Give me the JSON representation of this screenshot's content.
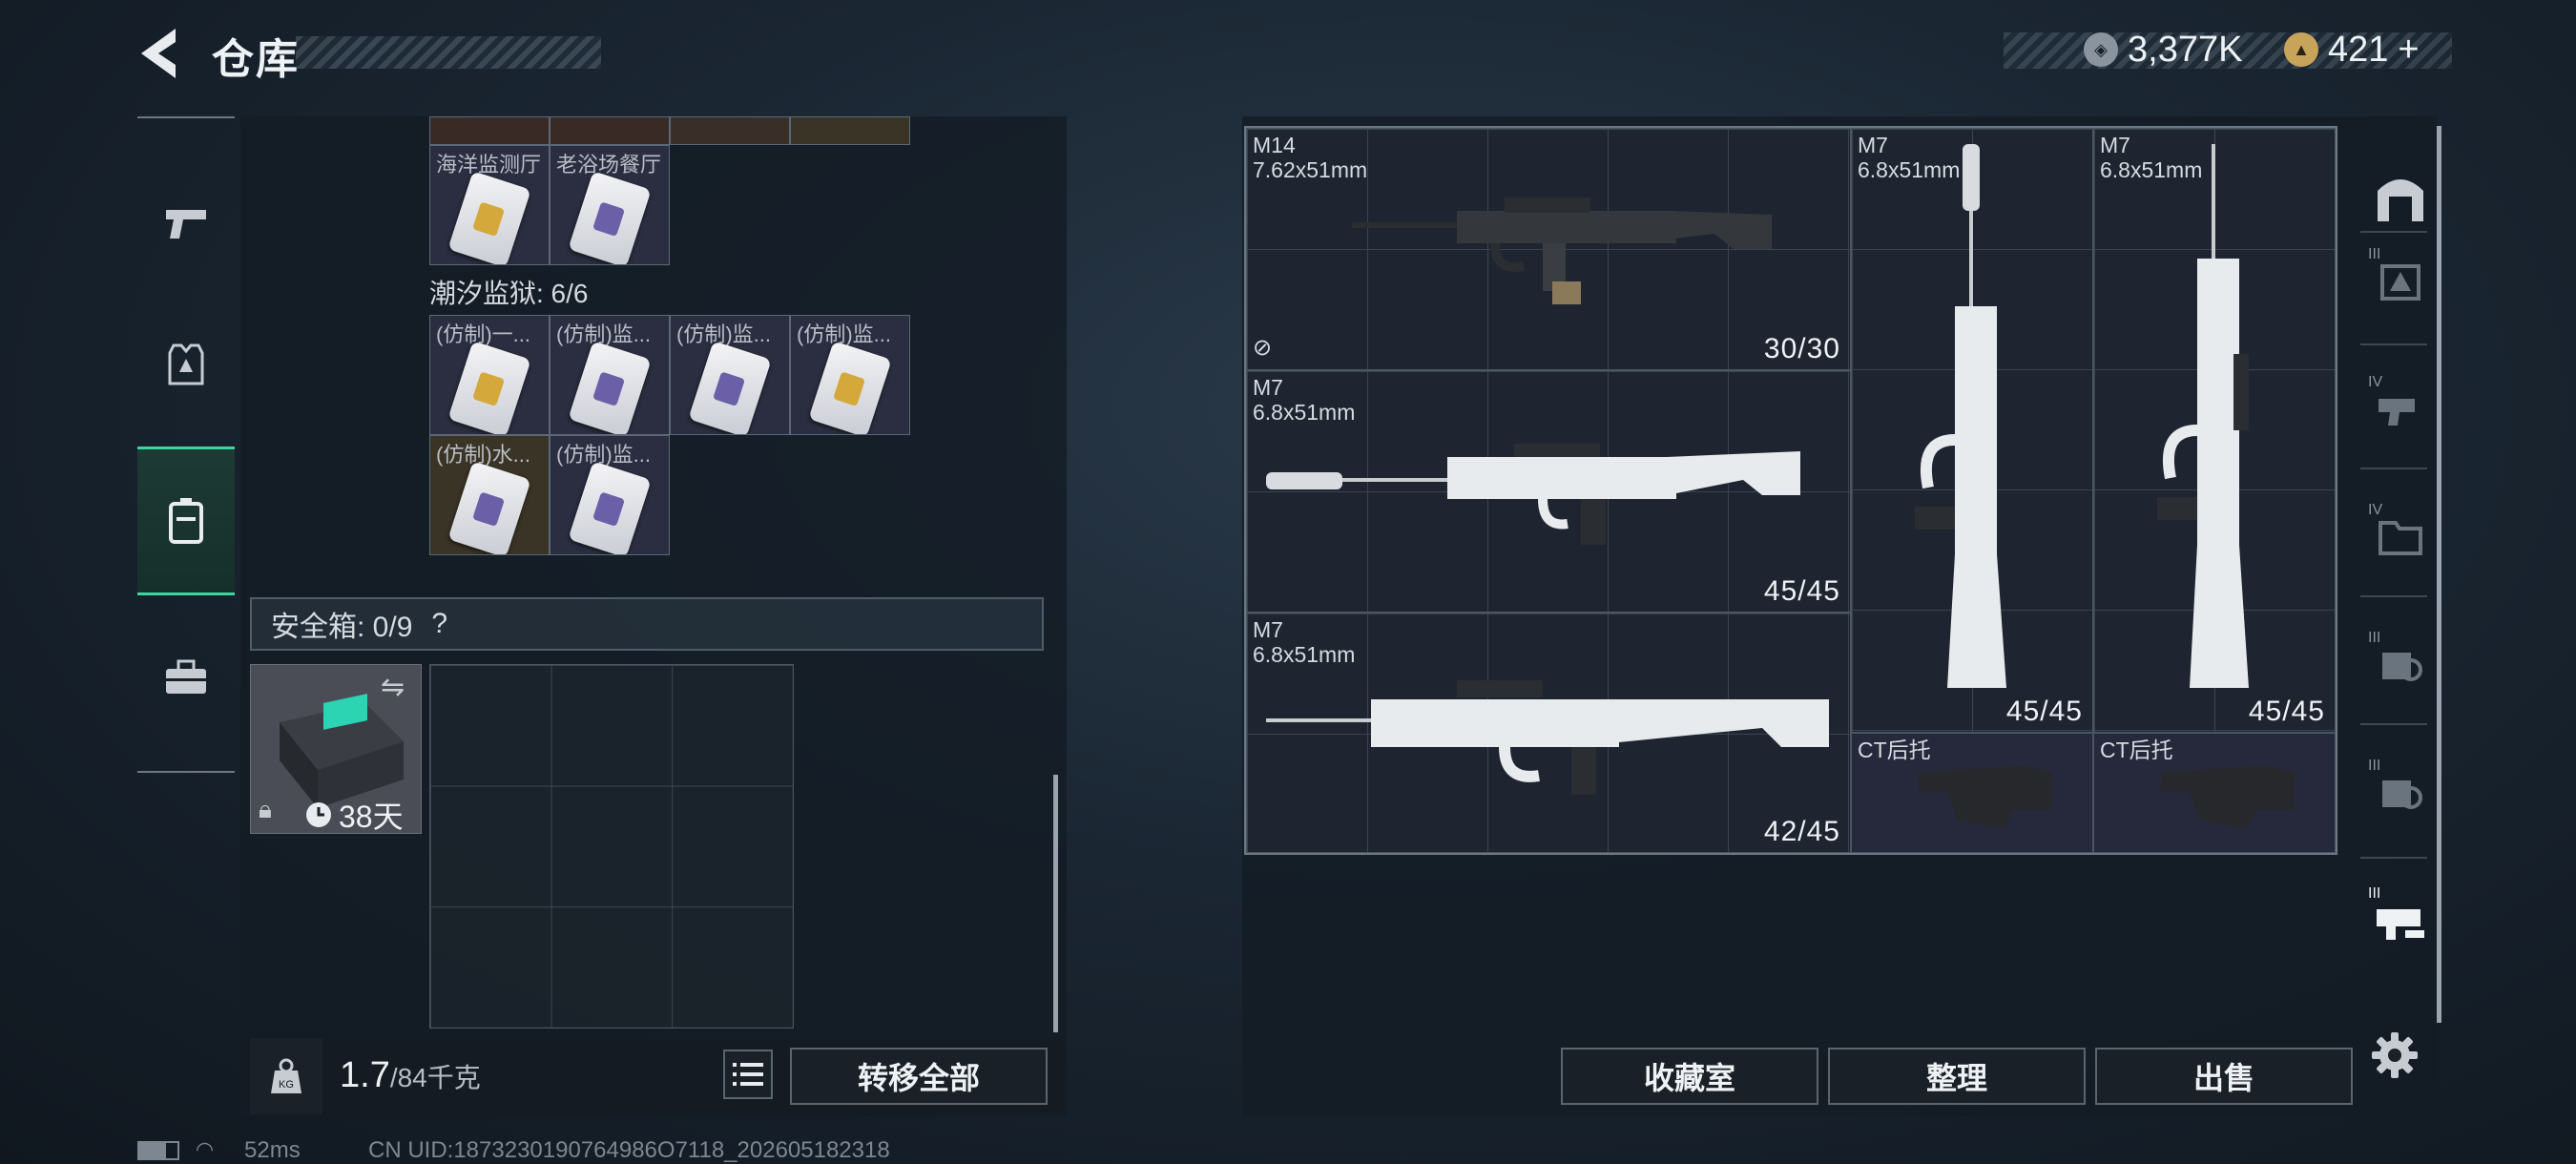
{
  "header": {
    "title": "仓库"
  },
  "currency": [
    {
      "icon": "silver-coin-icon",
      "value": "3,377K",
      "color": "#b8bec6"
    },
    {
      "icon": "gold-coin-icon",
      "value": "421",
      "plus": "+",
      "color": "#c8a45a"
    }
  ],
  "left_nav": [
    {
      "icon": "pistol-icon"
    },
    {
      "icon": "armor-icon"
    },
    {
      "icon": "backpack-icon",
      "active": true
    },
    {
      "icon": "briefcase-icon"
    }
  ],
  "inventory": {
    "top_row": [
      {
        "label": "海洋监测厅",
        "tint": "yellow"
      },
      {
        "label": "老浴场餐厅",
        "tint": "purple"
      }
    ],
    "group_title": "潮汐监狱: 6/6",
    "group_items": [
      {
        "label": "(仿制)一...",
        "tint": "yellow",
        "bg": "purple"
      },
      {
        "label": "(仿制)监...",
        "tint": "purple",
        "bg": "purple"
      },
      {
        "label": "(仿制)监...",
        "tint": "purple",
        "bg": "purple"
      },
      {
        "label": "(仿制)监...",
        "tint": "yellow",
        "bg": "purple"
      },
      {
        "label": "(仿制)水...",
        "tint": "purple",
        "bg": "gold"
      },
      {
        "label": "(仿制)监...",
        "tint": "purple",
        "bg": "purple"
      }
    ]
  },
  "safe_box": {
    "label": "安全箱: 0/9",
    "help": "?",
    "duration": "38天"
  },
  "weight": {
    "current": "1.7",
    "max": "/84千克"
  },
  "buttons": {
    "transfer_all": "转移全部",
    "collection": "收藏室",
    "organize": "整理",
    "sell": "出售"
  },
  "weapons": [
    {
      "name": "M14",
      "caliber": "7.62x51mm",
      "ammo": "30/30"
    },
    {
      "name": "M7",
      "caliber": "6.8x51mm",
      "ammo": "45/45"
    },
    {
      "name": "M7",
      "caliber": "6.8x51mm",
      "ammo": "42/45"
    },
    {
      "name": "M7",
      "caliber": "6.8x51mm",
      "ammo": "45/45"
    },
    {
      "name": "M7",
      "caliber": "6.8x51mm",
      "ammo": "45/45"
    }
  ],
  "stocks": [
    {
      "name": "CT后托"
    },
    {
      "name": "CT后托"
    }
  ],
  "right_nav": {
    "tier_labels": [
      "III",
      "IV",
      "IV",
      "III",
      "III",
      "III"
    ]
  },
  "status_bar": {
    "ping": "52ms",
    "uid": "CN UID:1873230190764986O7118_202605182318"
  }
}
